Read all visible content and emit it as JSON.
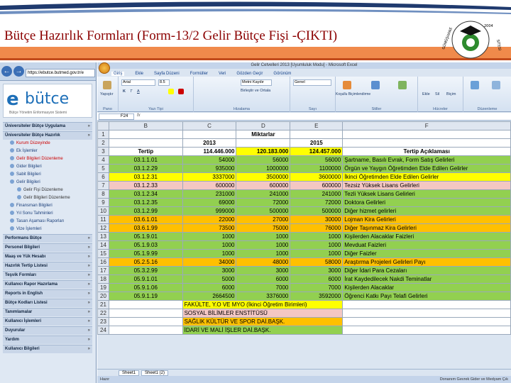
{
  "slide": {
    "title": "Bütçe Hazırlık Formları (Form-13/2 Gelir Bütçe Fişi -ÇIKTI)",
    "logo_year": "2004",
    "logo_left_text": "GÜMÜŞHANE",
    "logo_right_text": "SİTESİ"
  },
  "browser": {
    "url": "https://ebutce.butmed.gov.tr/e",
    "logo_e": "e",
    "logo_word": "bütce",
    "logo_sub": "Bütçe Yönetim Enformasyon Sistemi",
    "menu": [
      {
        "label": "Üniversiteler Bütçe Uygulama",
        "type": "head"
      },
      {
        "label": "Üniversiteler Bütçe Hazırlık",
        "type": "head"
      },
      {
        "label": "Kurum Düzeyinde",
        "type": "sub",
        "selected": true
      },
      {
        "label": "Ek İşlemler",
        "type": "sub"
      },
      {
        "label": "Gelir Bilgileri Düzenleme",
        "type": "sub",
        "selected": true
      },
      {
        "label": "Gider Bilgileri",
        "type": "sub"
      },
      {
        "label": "Sabit Bilgileri",
        "type": "sub"
      },
      {
        "label": "Gelir Bilgileri",
        "type": "sub"
      },
      {
        "label": "Gelir Fişi Düzenleme",
        "type": "lvl2"
      },
      {
        "label": "Gelir Bilgileri Düzenleme",
        "type": "lvl2",
        "selected": true
      },
      {
        "label": "Finansman Bilgileri",
        "type": "sub"
      },
      {
        "label": "Yıl Sonu Tahminleri",
        "type": "sub"
      },
      {
        "label": "Tasarı Aşaması Raporları",
        "type": "sub"
      },
      {
        "label": "Vize İşlemleri",
        "type": "sub"
      },
      {
        "label": "Performans Bütçe",
        "type": "head"
      },
      {
        "label": "Personel Bilgileri",
        "type": "head"
      },
      {
        "label": "Maaş ve Yük Hesabı",
        "type": "head"
      },
      {
        "label": "Hazırlık Tertip Listesi",
        "type": "head"
      },
      {
        "label": "Teşvik Formları",
        "type": "head"
      },
      {
        "label": "Kullanıcı Rapor Hazırlama",
        "type": "head"
      },
      {
        "label": "Reports in English",
        "type": "head"
      },
      {
        "label": "Bütçe Kodları Listesi",
        "type": "head"
      },
      {
        "label": "Tanımlamalar",
        "type": "head"
      },
      {
        "label": "Kullanıcı İşlemleri",
        "type": "head"
      },
      {
        "label": "Duyurular",
        "type": "head"
      },
      {
        "label": "Yardım",
        "type": "head"
      },
      {
        "label": "Kullanıcı Bilgileri",
        "type": "head"
      }
    ]
  },
  "excel": {
    "title": "Gelir Cetvelleri 2013 [Uyumluluk Modu] - Microsoft Excel",
    "tabs": [
      "Giriş",
      "Ekle",
      "Sayfa Düzeni",
      "Formüller",
      "Veri",
      "Gözden Geçir",
      "Görünüm"
    ],
    "font_name": "Arial",
    "font_size": "8.5",
    "number_format": "Genel",
    "ribbon_groups": [
      "Pano",
      "Yazı Tipi",
      "Hizalama",
      "Sayı",
      "Stiller",
      "Hücreler",
      "Düzenleme"
    ],
    "ribbon_buttons": [
      "Yapıştır",
      "Metni Kaydır",
      "Birleştir ve Ortala",
      "Koşullu Biçimlendirme",
      "Tablo Olarak Biçimlendir",
      "Hücre Stilleri",
      "Ekle",
      "Sil",
      "Biçim",
      "Sırala ve Filtre Uygula",
      "Bul ve Seç"
    ],
    "name_box": "F24",
    "fx": "fx",
    "columns": [
      "B",
      "C",
      "D",
      "E",
      "F"
    ],
    "sheet_tabs": [
      "Sheet1",
      "Sheet1 (2)"
    ],
    "status": "Hazır",
    "footer_note": "Donanım Gevrek Gider ve Medyam Çık"
  },
  "sheet": {
    "header_row1": {
      "col_d": "Miktarlar"
    },
    "header_row2": {
      "c": "2013",
      "e": "2015"
    },
    "header_row3": {
      "b": "Tertip",
      "c": "114.446.000",
      "d": "120.183.000",
      "e": "124.457.000",
      "f": "Tertip Açıklaması"
    },
    "rows": [
      {
        "n": "4",
        "b": "03.1.1.01",
        "c": "54000",
        "d": "56000",
        "e": "56000",
        "f": "Şartname, Basılı Evrak, Form Satış Gelirleri",
        "color": "g"
      },
      {
        "n": "5",
        "b": "03.1.2.29",
        "c": "935000",
        "d": "1000000",
        "e": "1100000",
        "f": "Örgün ve Yaygın Öğretimden Elde Edilen Gelirler",
        "color": "g"
      },
      {
        "n": "6",
        "b": "03.1.2.31",
        "c": "3337000",
        "d": "3500000",
        "e": "3600000",
        "f": "İkinci Öğretimden Elde Edilen Gelirler",
        "color": "y"
      },
      {
        "n": "7",
        "b": "03.1.2.33",
        "c": "600000",
        "d": "600000",
        "e": "600000",
        "f": "Tezsiz Yüksek Lisans Gelirleri",
        "color": "pk"
      },
      {
        "n": "8",
        "b": "03.1.2.34",
        "c": "231000",
        "d": "241000",
        "e": "241000",
        "f": "Tezli Yüksek Lisans Gelirleri",
        "color": "g"
      },
      {
        "n": "9",
        "b": "03.1.2.35",
        "c": "69000",
        "d": "72000",
        "e": "72000",
        "f": "Doktora Gelirleri",
        "color": "g"
      },
      {
        "n": "10",
        "b": "03.1.2.99",
        "c": "999000",
        "d": "500000",
        "e": "500000",
        "f": "Diğer hizmet gelirleri",
        "color": "g"
      },
      {
        "n": "11",
        "b": "03.6.1.01",
        "c": "22000",
        "d": "27000",
        "e": "30000",
        "f": "Lojman Kira Gelirleri",
        "color": "o"
      },
      {
        "n": "12",
        "b": "03.6.1.99",
        "c": "73500",
        "d": "75000",
        "e": "76000",
        "f": "Diğer Taşınmaz Kira Gelirleri",
        "color": "o"
      },
      {
        "n": "13",
        "b": "05.1.9.01",
        "c": "1000",
        "d": "1000",
        "e": "1000",
        "f": "Kişilerden Alacaklar Faizleri",
        "color": "g"
      },
      {
        "n": "14",
        "b": "05.1.9.03",
        "c": "1000",
        "d": "1000",
        "e": "1000",
        "f": "Mevduat Faizleri",
        "color": "g"
      },
      {
        "n": "15",
        "b": "05.1.9.99",
        "c": "1000",
        "d": "1000",
        "e": "1000",
        "f": "Diğer Faizler",
        "color": "g"
      },
      {
        "n": "16",
        "b": "05.2.5.16",
        "c": "34000",
        "d": "48000",
        "e": "58000",
        "f": "Araştırma Projeleri Gelirleri Payı",
        "color": "o"
      },
      {
        "n": "17",
        "b": "05.3.2.99",
        "c": "3000",
        "d": "3000",
        "e": "3000",
        "f": "Diğer İdari Para Cezaları",
        "color": "g"
      },
      {
        "n": "18",
        "b": "05.9.1.01",
        "c": "5000",
        "d": "6000",
        "e": "6000",
        "f": "İrat Kaydedilecek Nakdi Teminatlar",
        "color": "g"
      },
      {
        "n": "19",
        "b": "05.9.1.06",
        "c": "6000",
        "d": "7000",
        "e": "7000",
        "f": "Kişilerden Alacaklar",
        "color": "g"
      },
      {
        "n": "20",
        "b": "05.9.1.19",
        "c": "2664500",
        "d": "3376000",
        "e": "3592000",
        "f": "Öğrenci Katkı Payı Telafi Gelirleri",
        "color": "g"
      }
    ],
    "legend": [
      {
        "n": "21",
        "text": "FAKÜLTE, Y.O VE MYO (İkinci Öğretim Birimleri)",
        "color": "y"
      },
      {
        "n": "22",
        "text": "SOSYAL BİLİMLER ENSTİTÜSÜ",
        "color": "pk"
      },
      {
        "n": "23",
        "text": "SAĞLIK KÜLTÜR VE SPOR DAİ.BAŞK.",
        "color": "o"
      },
      {
        "n": "24",
        "text": "İDARİ VE MALİ İŞLER DAİ.BAŞK.",
        "color": "g"
      }
    ],
    "row_numbers_top": [
      "1",
      "2",
      "3"
    ],
    "colors": {
      "g": "#92d050",
      "y": "#ffff00",
      "o": "#ffc000",
      "pk": "#f4c7c3"
    }
  }
}
